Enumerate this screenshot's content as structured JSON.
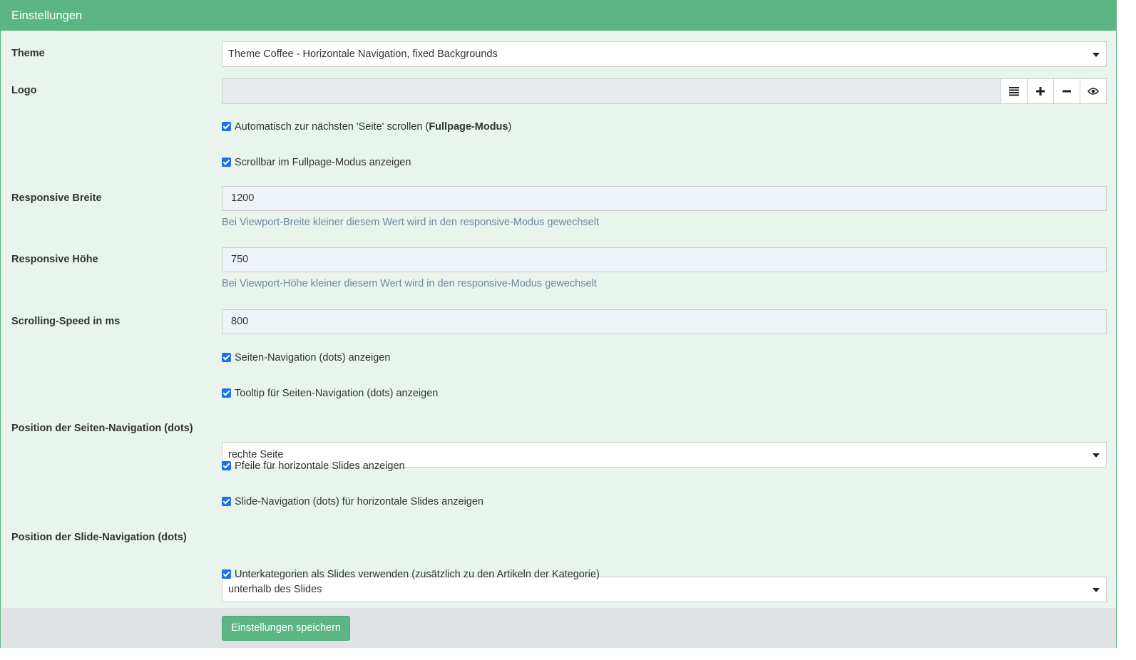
{
  "header": {
    "title": "Einstellungen"
  },
  "theme": {
    "label": "Theme",
    "value": "Theme Coffee - Horizontale Navigation, fixed Backgrounds"
  },
  "logo": {
    "label": "Logo",
    "value": ""
  },
  "checks": {
    "fullpage_prefix": "Automatisch zur nächsten 'Seite' scrollen (",
    "fullpage_bold": "Fullpage-Modus",
    "fullpage_suffix": ")",
    "scrollbar": "Scrollbar im Fullpage-Modus anzeigen",
    "dots": "Seiten-Navigation (dots) anzeigen",
    "tooltip": "Tooltip für Seiten-Navigation (dots) anzeigen",
    "arrows": "Pfeile für horizontale Slides anzeigen",
    "slide_dots": "Slide-Navigation (dots) für horizontale Slides anzeigen",
    "subcats": "Unterkategorien als Slides verwenden (zusätzlich zu den Artikeln der Kategorie)"
  },
  "responsive_width": {
    "label": "Responsive Breite",
    "value": "1200",
    "help": "Bei Viewport-Breite kleiner diesem Wert wird in den responsive-Modus gewechselt"
  },
  "responsive_height": {
    "label": "Responsive Höhe",
    "value": "750",
    "help": "Bei Viewport-Höhe kleiner diesem Wert wird in den responsive-Modus gewechselt"
  },
  "speed": {
    "label": "Scrolling-Speed in ms",
    "value": "800"
  },
  "dots_position": {
    "label": "Position der Seiten-Navigation (dots)",
    "value": "rechte Seite"
  },
  "slide_dots_position": {
    "label": "Position der Slide-Navigation (dots)",
    "value": "unterhalb des Slides"
  },
  "footer": {
    "save_label": "Einstellungen speichern"
  }
}
